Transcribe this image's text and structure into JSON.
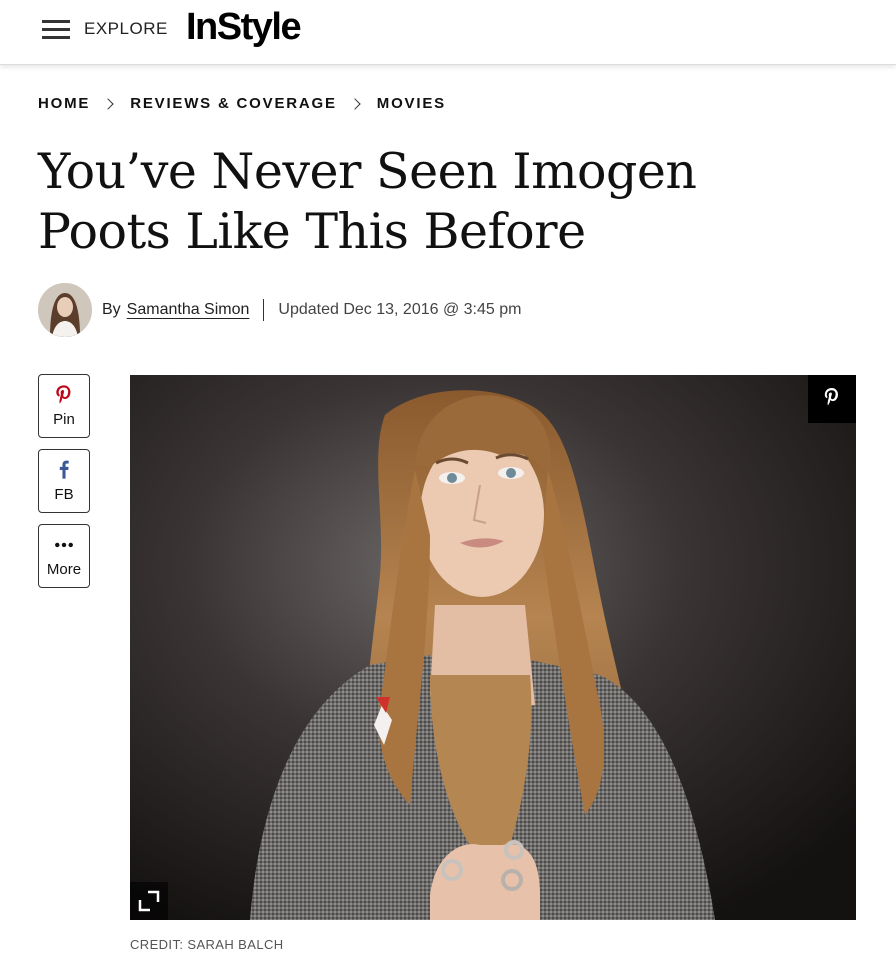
{
  "header": {
    "explore_label": "EXPLORE",
    "logo_text": "InStyle"
  },
  "breadcrumb": [
    "HOME",
    "REVIEWS & COVERAGE",
    "MOVIES"
  ],
  "article": {
    "title_line1": "You’ve Never Seen Imogen",
    "title_line2": "Poots Like This Before",
    "byline_prefix": "By",
    "author": "Samantha Simon",
    "updated": "Updated Dec 13, 2016 @ 3:45 pm",
    "photo_credit": "CREDIT: SARAH BALCH"
  },
  "share": [
    {
      "label": "Pin",
      "icon": "pinterest-icon",
      "color": "#bd081c"
    },
    {
      "label": "FB",
      "icon": "facebook-icon",
      "color": "#3b5998"
    },
    {
      "label": "More",
      "icon": "more-dots-icon",
      "color": "#111111"
    }
  ]
}
